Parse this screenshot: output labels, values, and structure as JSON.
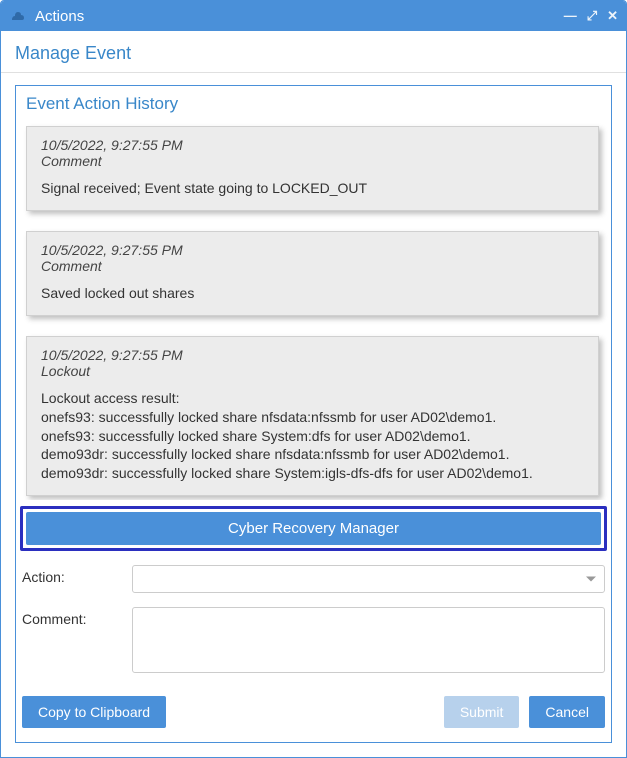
{
  "titlebar": {
    "title": "Actions"
  },
  "subheader": "Manage Event",
  "panel": {
    "title": "Event Action History"
  },
  "history": [
    {
      "ts": "10/5/2022, 9:27:55 PM",
      "type": "Comment",
      "message": "Signal received; Event state going to LOCKED_OUT"
    },
    {
      "ts": "10/5/2022, 9:27:55 PM",
      "type": "Comment",
      "message": "Saved locked out shares"
    },
    {
      "ts": "10/5/2022, 9:27:55 PM",
      "type": "Lockout",
      "message": "Lockout access result:\nonefs93: successfully locked share nfsdata:nfssmb for user AD02\\demo1.\nonefs93: successfully locked share System:dfs for user AD02\\demo1.\ndemo93dr: successfully locked share nfsdata:nfssmb for user AD02\\demo1.\ndemo93dr: successfully locked share System:igls-dfs-dfs for user AD02\\demo1."
    }
  ],
  "big_button": "Cyber Recovery Manager",
  "form": {
    "action_label": "Action:",
    "comment_label": "Comment:",
    "action_value": "",
    "comment_value": ""
  },
  "buttons": {
    "copy": "Copy to Clipboard",
    "submit": "Submit",
    "cancel": "Cancel"
  }
}
